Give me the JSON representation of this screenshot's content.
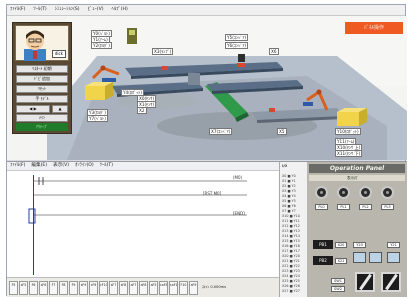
{
  "menubar": {
    "items": [
      "ﾌｧｲﾙ(F)",
      "ﾂｰﾙ(T)",
      "ｼﾐｭﾚｰｼｮﾝ(S)",
      "ﾋﾞｭｰ(V)",
      "ﾍﾙﾌﾟ(H)"
    ]
  },
  "sim": {
    "avatar_name": "dick",
    "buttons": [
      {
        "label": "ﾘｽﾀｰﾄ 初期"
      },
      {
        "label": "ﾄﾞﾋﾞ追加"
      },
      {
        "label": "ﾘｾｯﾄ"
      },
      {
        "label": "手  ﾓﾃﾞﾙ"
      },
      {
        "label": "◀  ▶"
      },
      {
        "label": "▲"
      },
      {
        "label": "ﾒｲﾝ"
      }
    ],
    "status": "ｱｸﾃｨﾌﾞ",
    "corner_panel": "ﾊﾟﾈﾙ操作",
    "tags": [
      {
        "text": "Y0(ﾍﾞﾙﾄ)"
      },
      {
        "text": "Y1(ｱｰﾑ)"
      },
      {
        "text": "Y2(ﾎﾙﾀﾞ)"
      },
      {
        "text": "X3(ﾗﾝﾌﾟ)"
      },
      {
        "text": "Y5(ｺﾝﾍﾞｱ)"
      },
      {
        "text": "Y6(ｺﾝﾍﾞｱ)"
      },
      {
        "text": "X6"
      },
      {
        "text": "Y4(ﾛﾎﾞｯﾄ)"
      },
      {
        "text": "X0(ｾﾝｻ)"
      },
      {
        "text": "X1(ｾﾝｻ)"
      },
      {
        "text": "X2"
      },
      {
        "text": "Y3(ﾎﾙﾀﾞ)"
      },
      {
        "text": "Y7(ﾍﾞﾙﾄ)"
      },
      {
        "text": "X7(ｺﾝﾍﾞｱ)"
      },
      {
        "text": "X5"
      },
      {
        "text": "Y10(ﾛﾎﾞｯﾄ)"
      },
      {
        "text": "Y11(ｱｰﾑ)"
      },
      {
        "text": "X10(ｾﾝｻ 上)"
      },
      {
        "text": "X11(ｾﾝｻ 下)"
      }
    ]
  },
  "editor": {
    "menu": [
      "ﾌｧｲﾙ(F)",
      "編集(E)",
      "表示(V)",
      "ｵﾝﾗｲﾝ(O)",
      "ﾂｰﾙ(T)"
    ],
    "rows": [
      {
        "label": "(M0)"
      },
      {
        "label": "[RST M0]"
      },
      {
        "label": "[END]"
      }
    ],
    "tools": [
      "F5",
      "sF5",
      "F6",
      "sF6",
      "F7",
      "F8",
      "F9",
      "sF9",
      "cF9",
      "cF10",
      "sF7",
      "sF8",
      "aF7",
      "aF8",
      "aF5",
      "caF5",
      "caF10",
      "F10",
      "aF9"
    ],
    "status": "ｽｷｬﾝ  0.000ms"
  },
  "io": {
    "header": "I/O",
    "rows": [
      "X0 ■ Y0",
      "X1 ■ Y1",
      "X2 ■ Y2",
      "X3 ■ Y3",
      "X4 ■ Y4",
      "X5 ■ Y5",
      "X6 ■ Y6",
      "X7 ■ Y7",
      "X10 ■ Y10",
      "X11 ■ Y11",
      "X12 ■ Y12",
      "X13 ■ Y13",
      "X14 ■ Y14",
      "X15 ■ Y15",
      "X16 ■ Y16",
      "X17 ■ Y17",
      "X20 ■ Y20",
      "X21 ■ Y21",
      "X22 ■ Y22",
      "X23 ■ Y23",
      "X24 ■ Y24",
      "X25 ■ Y25",
      "X26 ■ Y26",
      "X27 ■ Y27"
    ]
  },
  "oppanel": {
    "title": "Operation Panel",
    "strip": "表示灯",
    "knob_labels": [
      "PL0",
      "PL1",
      "PL2",
      "PL3"
    ],
    "pb1": "PB1",
    "pb2": "PB2",
    "pb1_tag": "X20",
    "pb2_tag": "X21",
    "lamp_tags": [
      "Y20",
      "Y21"
    ],
    "switch_tags": [
      "SW1",
      "SW2"
    ],
    "accent": "#ef5a22"
  }
}
